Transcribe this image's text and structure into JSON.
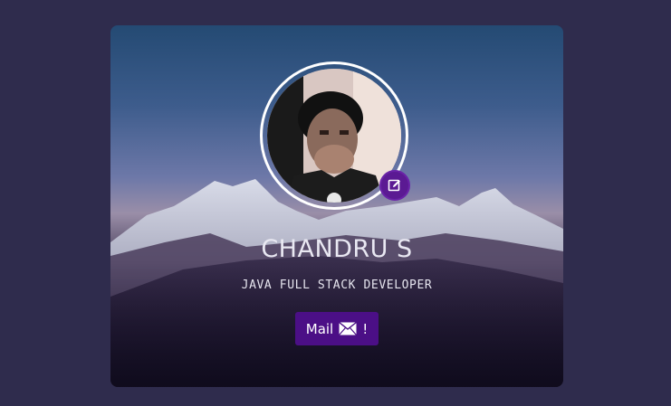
{
  "profile": {
    "name": "CHANDRU S",
    "role": "JAVA FULL STACK DEVELOPER"
  },
  "mail_button": {
    "label": "Mail",
    "suffix": "!",
    "icon": "envelope-icon"
  },
  "edit_button": {
    "icon": "edit-icon"
  },
  "colors": {
    "page_background": "#2f2c4d",
    "accent": "#4b0f86",
    "edit_accent": "#5b1a93"
  }
}
